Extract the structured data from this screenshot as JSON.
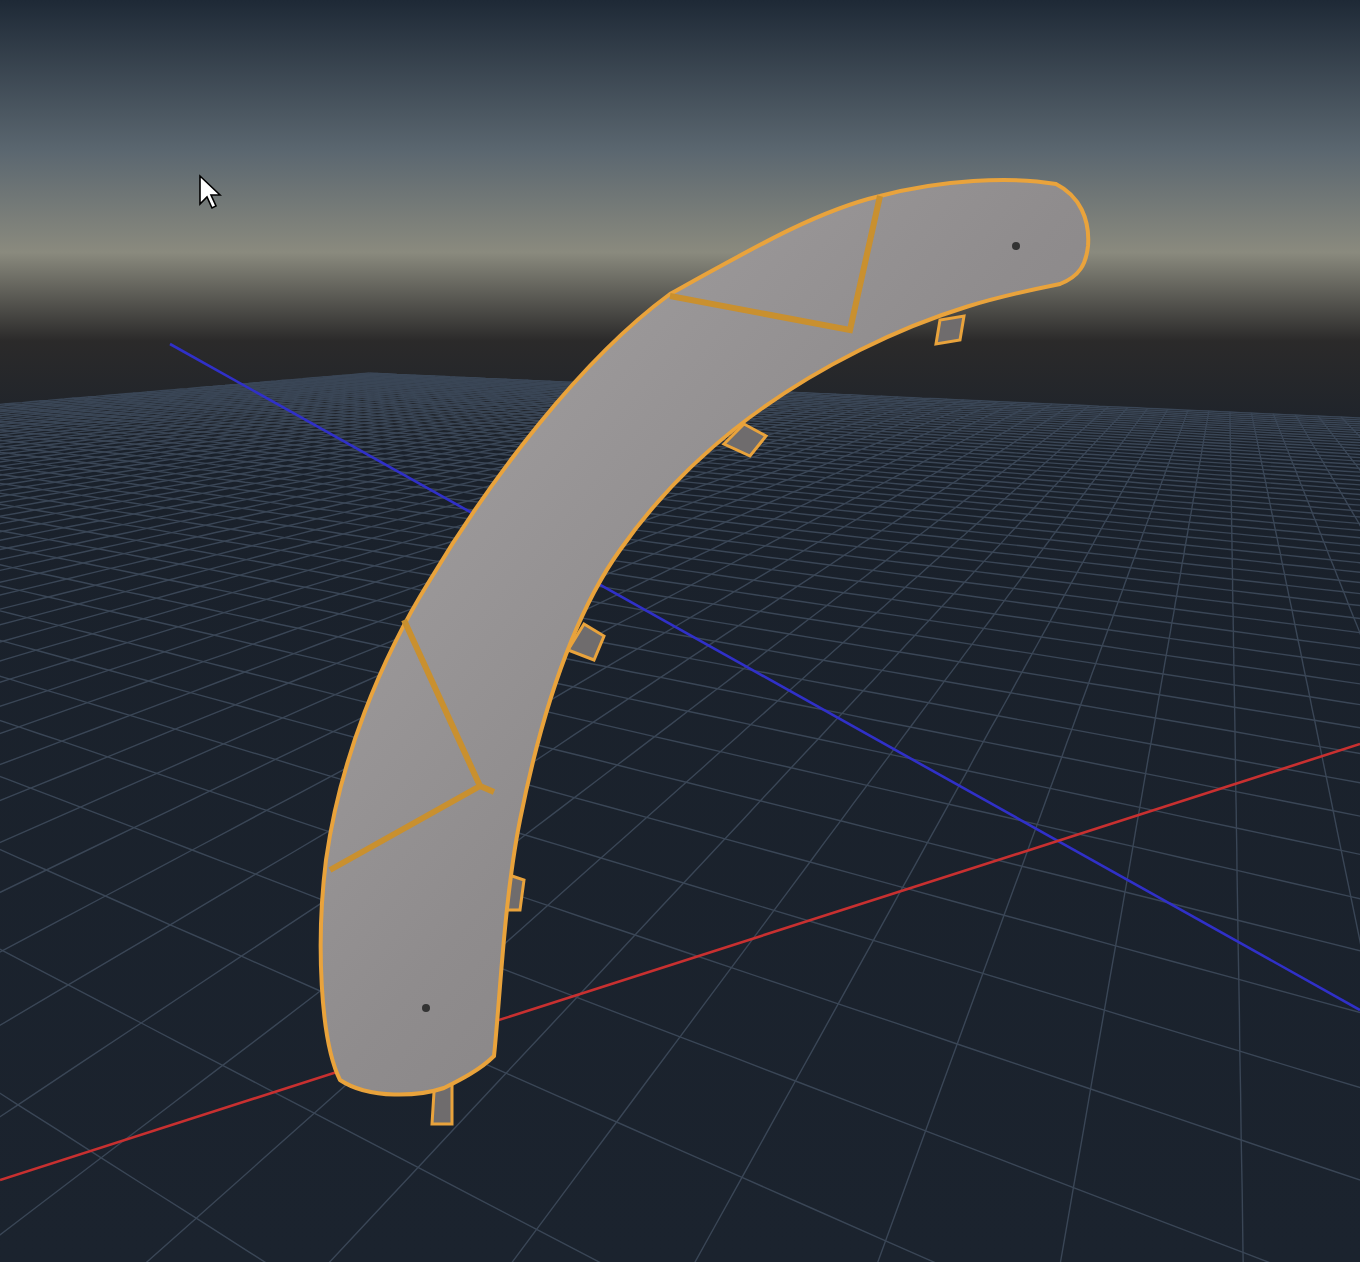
{
  "model": {
    "selected": true
  }
}
